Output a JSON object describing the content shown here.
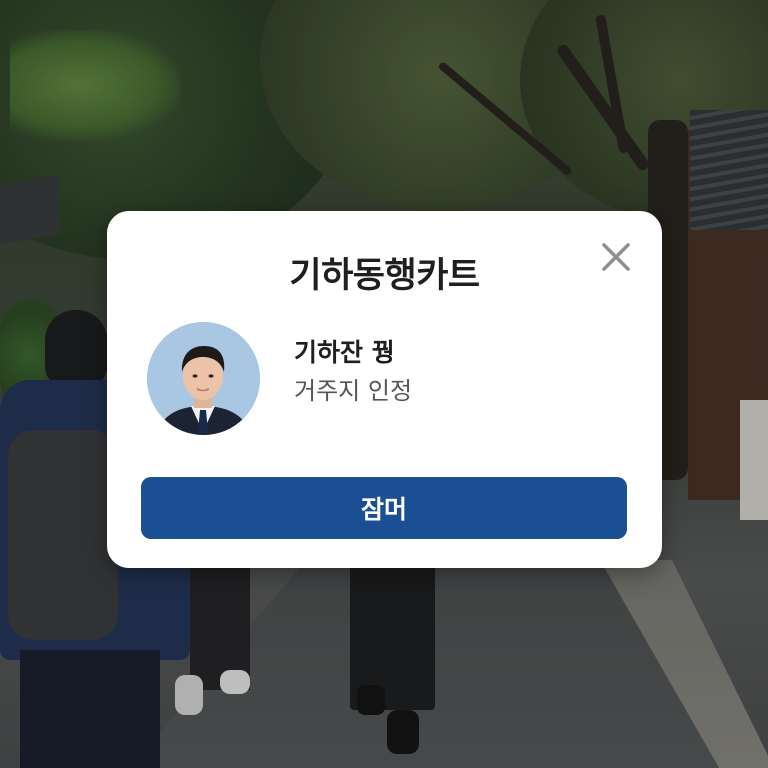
{
  "modal": {
    "title": "기하동행카트",
    "close_icon": "close-icon",
    "profile": {
      "avatar_icon": "user-avatar-photo",
      "name": "기하잔 꿩",
      "status": "거주지 인정"
    },
    "primary_button_label": "잠머"
  },
  "colors": {
    "modal_background": "#ffffff",
    "primary_button": "#1b4f93",
    "primary_button_text": "#ffffff",
    "title_text": "#1f1f1f",
    "status_text": "#555555",
    "close_icon": "#8e8e8e"
  }
}
